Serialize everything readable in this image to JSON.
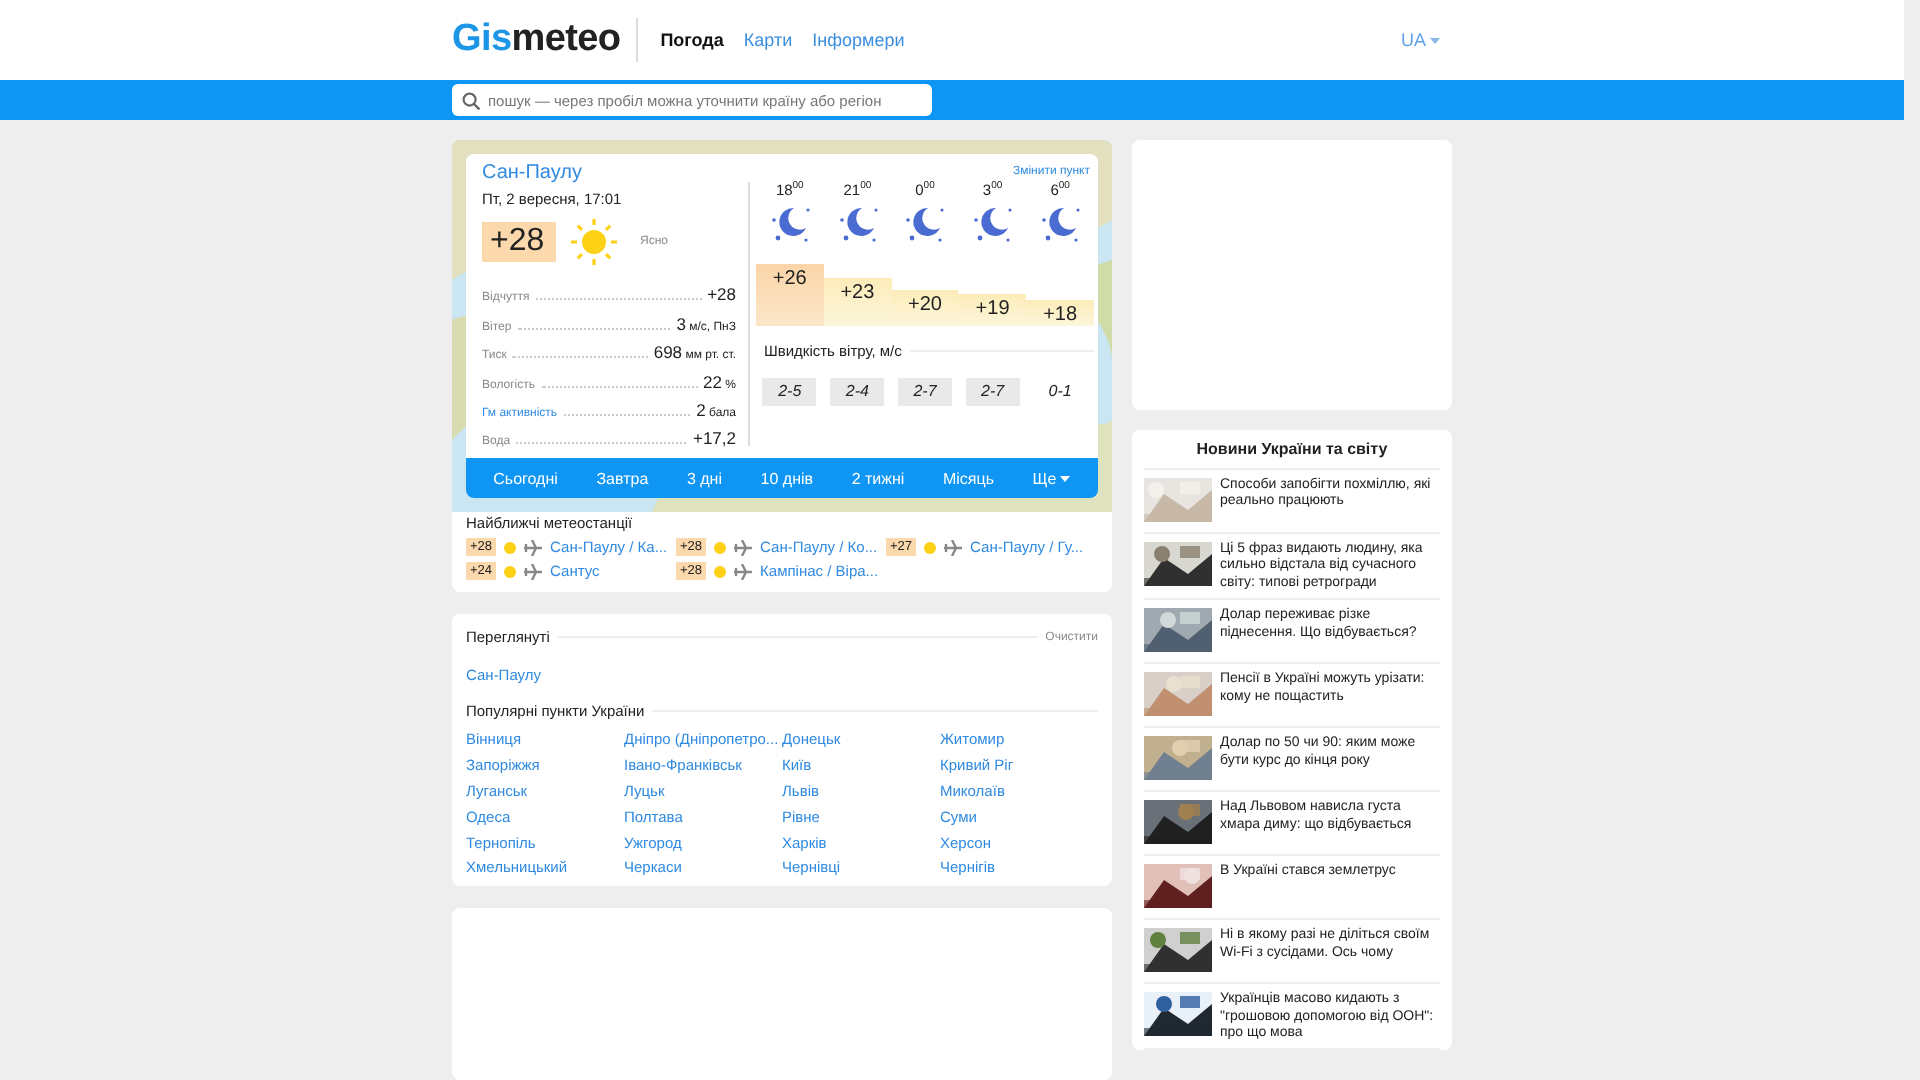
{
  "header": {
    "logo": {
      "accent": "Gis",
      "rest": "meteo"
    },
    "nav": [
      {
        "label": "Погода",
        "selected": true
      },
      {
        "label": "Карти",
        "selected": false
      },
      {
        "label": "Інформери",
        "selected": false
      }
    ],
    "language": "UA"
  },
  "search": {
    "placeholder": "пошук — через пробіл можна уточнити країну або регіон"
  },
  "weather": {
    "city": "Сан-Паулу",
    "change_link": "Змінити пункт",
    "date": "Пт, 2 вересня, 17:01",
    "temperature": "+28",
    "condition": "Ясно",
    "kind": "sunny",
    "params": [
      {
        "label": "Відчуття",
        "value": "+28",
        "kind": "plain"
      },
      {
        "label": "Вітер",
        "value": "3",
        "unit": "м/с, ПнЗ",
        "kind": "plain"
      },
      {
        "label": "Тиск",
        "value": "698",
        "unit": "мм рт. ст.",
        "kind": "plain"
      },
      {
        "label": "Вологість",
        "value": "22",
        "unit": "%",
        "kind": "plain"
      },
      {
        "label": "Гм активність",
        "value": "2",
        "unit": "бала",
        "kind": "link"
      },
      {
        "label": "Вода",
        "value": "+17,2",
        "kind": "plain"
      }
    ],
    "hours": [
      {
        "time": "18$^{00}$",
        "kind": "clear_night",
        "temp": "+26",
        "wind": "2-5",
        "gusty": true
      },
      {
        "time": "21$^{00}$",
        "kind": "clear_night",
        "temp": "+23",
        "wind": "2-4",
        "gusty": true
      },
      {
        "time": "0$^{00}$",
        "kind": "clear_night",
        "temp": "+20",
        "wind": "2-7",
        "gusty": true
      },
      {
        "time": "3$^{00}$",
        "kind": "clear_night",
        "temp": "+19",
        "wind": "2-7",
        "gusty": true
      },
      {
        "time": "6$^{00}$",
        "kind": "clear_night",
        "temp": "+18",
        "wind": "0-1",
        "gusty": false
      }
    ],
    "wind_title": "Швидкість вітру, м/с",
    "tabs": [
      {
        "label": "Сьогодні",
        "selected": false
      },
      {
        "label": "Завтра",
        "selected": false
      },
      {
        "label": "3 дні",
        "selected": false
      },
      {
        "label": "10 днів",
        "selected": false
      },
      {
        "label": "2 тижні",
        "selected": false
      },
      {
        "label": "Місяць",
        "selected": false
      },
      {
        "label": "Ще",
        "selected": false,
        "dropdown": true
      }
    ]
  },
  "stations": {
    "title": "Найближчі метеостанції",
    "items": [
      {
        "temp": "+28",
        "name": "Сан-Паулу / Ка..."
      },
      {
        "temp": "+28",
        "name": "Сан-Паулу / Ко..."
      },
      {
        "temp": "+27",
        "name": "Сан-Паулу / Гу..."
      },
      {
        "temp": "+24",
        "name": "Сантус"
      },
      {
        "temp": "+28",
        "name": "Кампінас / Віра..."
      }
    ]
  },
  "viewed": {
    "title": "Переглянуті",
    "clear": "Очистити",
    "items": [
      "Сан-Паулу"
    ],
    "popular_title": "Популярні пункти України",
    "popular": [
      "Вінниця",
      "Дніпро (Дніпропетро...",
      "Донецьк",
      "Житомир",
      "Запоріжжя",
      "Івано-Франківськ",
      "Київ",
      "Кривий Ріг",
      "Луганськ",
      "Луцьк",
      "Львів",
      "Миколаїв",
      "Одеса",
      "Полтава",
      "Рівне",
      "Суми",
      "Тернопіль",
      "Ужгород",
      "Харків",
      "Херсон",
      "Хмельницький",
      "Черкаси",
      "Чернівці",
      "Чернігів"
    ]
  },
  "news": {
    "title": "Новини України та світу",
    "items": [
      {
        "text": "Способи запобігти похміллю, які реально працюють",
        "kind": "picture"
      },
      {
        "text": "Ці 5 фраз видають людину, яка сильно відстала від сучасного світу: типові ретрогради",
        "kind": "picture"
      },
      {
        "text": "Долар переживає різке піднесення. Що відбувається?",
        "kind": "picture"
      },
      {
        "text": "Пенсії в Україні можуть урізати: кому не пощастить",
        "kind": "picture"
      },
      {
        "text": "Долар по 50 чи 90: яким може бути курс до кінця року",
        "kind": "picture"
      },
      {
        "text": "Над Львовом нависла густа хмара диму: що відбувається",
        "kind": "picture"
      },
      {
        "text": "В Україні стався землетрус",
        "kind": "picture"
      },
      {
        "text": "Ні в якому разі не діліться своїм Wi-Fi з сусідами. Ось чому",
        "kind": "picture"
      },
      {
        "text": "Українців масово кидають з \"грошовою допомогою від ООН\": про що мова",
        "kind": "picture"
      }
    ]
  }
}
